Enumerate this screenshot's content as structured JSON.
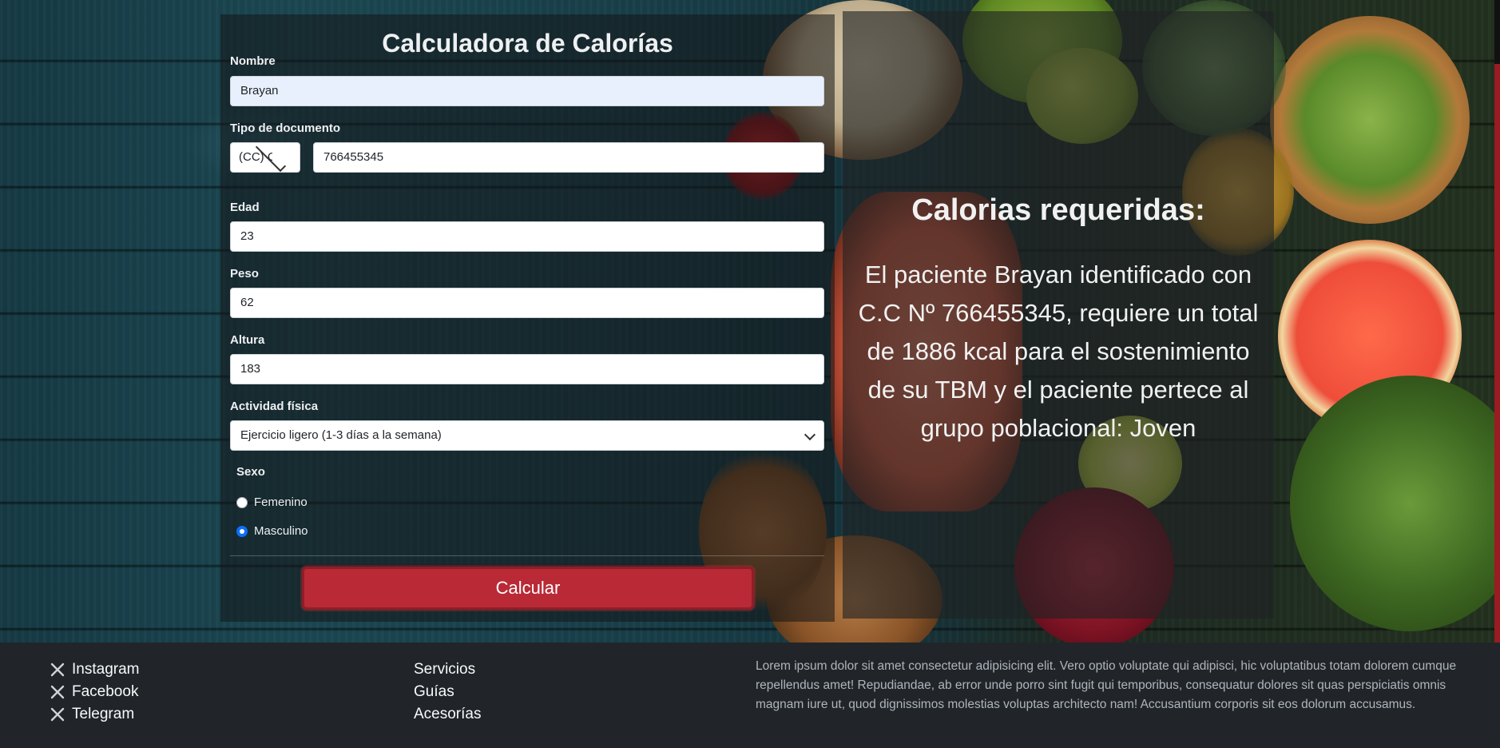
{
  "form": {
    "title": "Calculadora de Calorías",
    "name_label": "Nombre",
    "name_value": "Brayan",
    "doc_type_label": "Tipo de documento",
    "doc_type_value": "(CC) C",
    "doc_number_value": "766455345",
    "age_label": "Edad",
    "age_value": "23",
    "weight_label": "Peso",
    "weight_value": "62",
    "height_label": "Altura",
    "height_value": "183",
    "activity_label": "Actividad física",
    "activity_value": "Ejercicio ligero (1-3 días a la semana)",
    "sex_label": "Sexo",
    "sex_options": [
      {
        "label": "Femenino",
        "checked": false
      },
      {
        "label": "Masculino",
        "checked": true
      }
    ],
    "submit_label": "Calcular"
  },
  "result": {
    "title": "Calorias requeridas:",
    "text": "El paciente Brayan identificado con C.C Nº 766455345, requiere un total de 1886 kcal para el sostenimiento de su TBM y el paciente pertece al grupo poblacional: Joven"
  },
  "footer": {
    "social": [
      "Instagram",
      "Facebook",
      "Telegram"
    ],
    "links": [
      "Servicios",
      "Guías",
      "Acesorías"
    ],
    "lorem": "Lorem ipsum dolor sit amet consectetur adipisicing elit. Vero optio voluptate qui adipisci, hic voluptatibus totam dolorem cumque repellendus amet! Repudiandae, ab error unde porro sint fugit qui temporibus, consequatur dolores sit quas perspiciatis omnis magnam iure ut, quod dignissimos molestias voluptas architecto nam! Accusantium corporis sit eos dolorum accusamus."
  },
  "colors": {
    "button_bg": "#b92a36",
    "footer_bg": "#212529",
    "radio_checked": "#0d6efd"
  }
}
